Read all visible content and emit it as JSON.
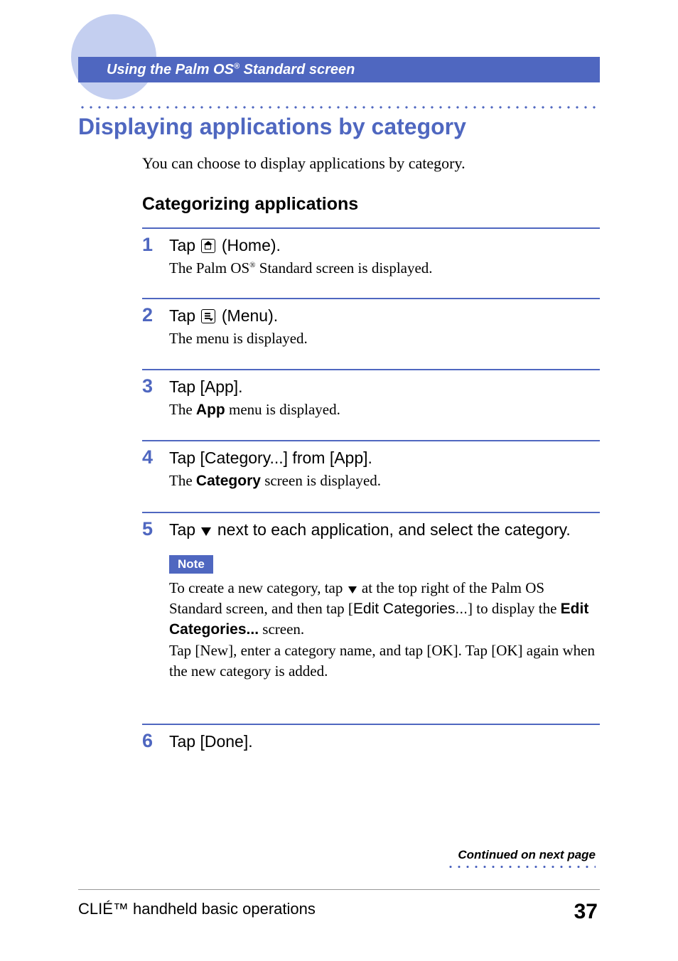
{
  "header": {
    "title_pre": "Using the Palm OS",
    "title_sup": "®",
    "title_post": " Standard screen"
  },
  "section": {
    "title": "Displaying applications by category",
    "intro": "You can choose to display applications by category.",
    "subtitle": "Categorizing applications"
  },
  "steps": [
    {
      "num": "1",
      "action_pre": "Tap ",
      "icon": "home",
      "action_post": " (Home).",
      "detail_pre": "The Palm OS",
      "detail_sup": "®",
      "detail_post": " Standard screen is displayed."
    },
    {
      "num": "2",
      "action_pre": "Tap ",
      "icon": "menu",
      "action_post": " (Menu).",
      "detail": "The menu is displayed."
    },
    {
      "num": "3",
      "action": "Tap [App].",
      "detail_pre": "The ",
      "detail_bold": "App",
      "detail_post": " menu is displayed."
    },
    {
      "num": "4",
      "action": "Tap [Category...] from [App].",
      "detail_pre": "The ",
      "detail_bold": "Category",
      "detail_post": " screen is displayed."
    },
    {
      "num": "5",
      "action_pre": "Tap ",
      "action_tri": true,
      "action_post": " next to each application, and select the category.",
      "note": {
        "label": "Note",
        "text_part1": "To create a new category, tap ",
        "text_part2": " at the top right of the Palm OS Standard screen, and then tap [",
        "edit_label": "Edit Categories...",
        "text_part3": "] to display the ",
        "edit_bold": "Edit Categories...",
        "text_part4": " screen.",
        "text_part5": "Tap [New], enter a category name, and tap [OK]. Tap [OK] again when the new category is added."
      }
    },
    {
      "num": "6",
      "action": "Tap [Done]."
    }
  ],
  "continued": "Continued on next page",
  "footer": {
    "left": "CLIÉ™ handheld basic operations",
    "page": "37"
  }
}
